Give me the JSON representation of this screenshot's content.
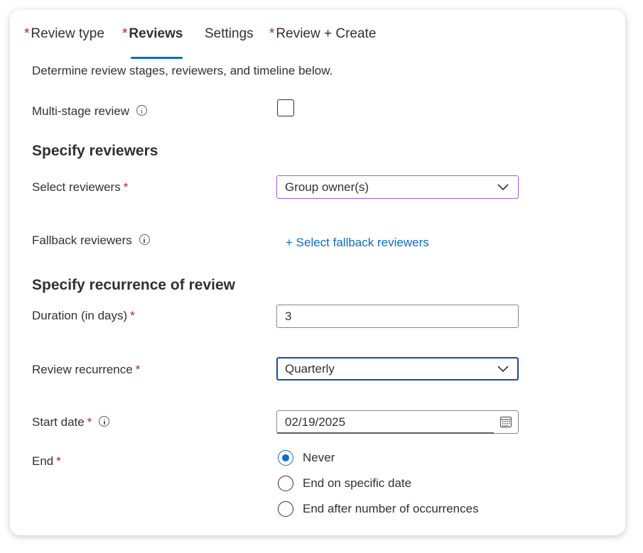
{
  "tabs": [
    {
      "label": "Review type",
      "required": "*",
      "active": false
    },
    {
      "label": "Reviews",
      "required": "*",
      "active": true
    },
    {
      "label": "Settings",
      "required": "",
      "active": false
    },
    {
      "label": "Review + Create",
      "required": "*",
      "active": false
    }
  ],
  "description": "Determine review stages, reviewers, and timeline below.",
  "multi_stage": {
    "label": "Multi-stage review",
    "checked": false
  },
  "reviewers_section": {
    "title": "Specify reviewers",
    "select_label": "Select reviewers",
    "select_value": "Group owner(s)",
    "fallback_label": "Fallback reviewers",
    "fallback_link": "+ Select fallback reviewers"
  },
  "recurrence_section": {
    "title": "Specify recurrence of review",
    "duration_label": "Duration (in days)",
    "duration_value": "3",
    "recurrence_label": "Review recurrence",
    "recurrence_value": "Quarterly",
    "start_label": "Start date",
    "start_value": "02/19/2025",
    "end_label": "End",
    "end_options": [
      {
        "label": "Never",
        "checked": true
      },
      {
        "label": "End on specific date",
        "checked": false
      },
      {
        "label": "End after number of occurrences",
        "checked": false
      }
    ]
  },
  "required_marker": "*",
  "colors": {
    "accent": "#0f6cbd",
    "required": "#a4262c",
    "purple_border": "#a25bd6"
  }
}
